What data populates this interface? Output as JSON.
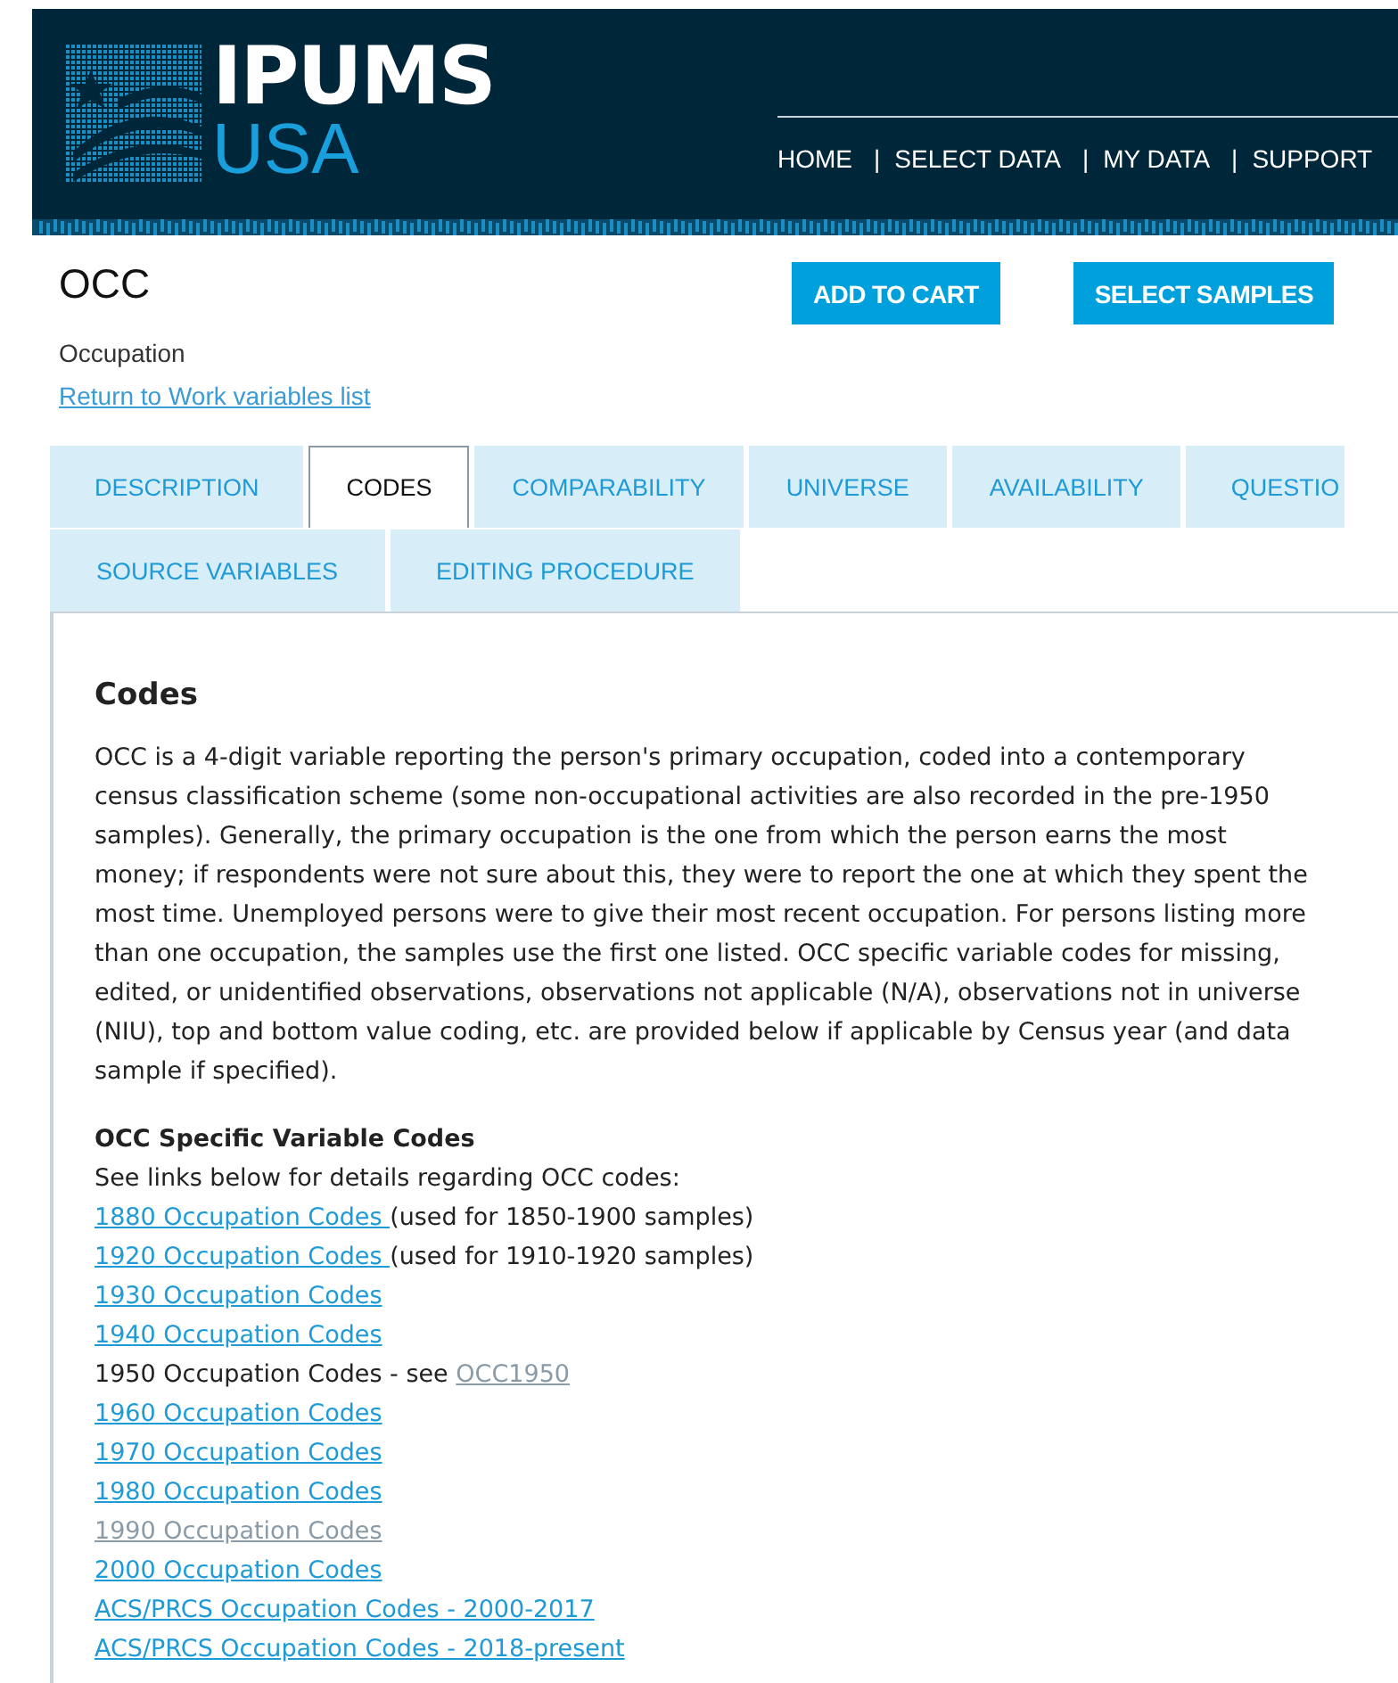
{
  "header": {
    "logo_top": "IPUMS",
    "logo_bottom": "USA",
    "nav": [
      {
        "label": "HOME"
      },
      {
        "label": "SELECT DATA",
        "separator": "|"
      },
      {
        "label": "MY DATA",
        "separator": "|"
      },
      {
        "label": "SUPPORT",
        "separator": "|"
      }
    ]
  },
  "variable": {
    "name": "OCC",
    "label": "Occupation",
    "back_link": "Return to Work variables list"
  },
  "buttons": [
    "ADD TO CART",
    "SELECT SAMPLES"
  ],
  "tab_rows": [
    [
      {
        "label": "DESCRIPTION",
        "selected": false
      },
      {
        "label": "CODES",
        "selected": true
      },
      {
        "label": "COMPARABILITY",
        "selected": false
      },
      {
        "label": "UNIVERSE",
        "selected": false
      },
      {
        "label": "AVAILABILITY",
        "selected": false
      },
      {
        "label": "QUESTIO",
        "selected": false
      }
    ],
    [
      {
        "label": "SOURCE VARIABLES",
        "selected": false
      },
      {
        "label": "EDITING PROCEDURE",
        "selected": false
      }
    ]
  ],
  "panel": {
    "heading": "Codes",
    "paragraph": "OCC is a 4-digit variable reporting the person's primary occupation, coded into a contemporary census classification scheme (some non-occupational activities are also recorded in the pre-1950 samples). Generally, the primary occupation is the one from which the person earns the most money; if respondents were not sure about this, they were to report the one at which they spent the most time. Unemployed persons were to give their most recent occupation. For persons listing more than one occupation, the samples use the first one listed. OCC specific variable codes for missing, edited, or unidentified observations, observations not applicable (N/A), observations not in universe (NIU), top and bottom value coding, etc. are provided below if applicable by Census year (and data sample if specified).",
    "subheading": "OCC Specific Variable Codes",
    "intro": "See links below for details regarding OCC codes:",
    "code_items": [
      {
        "link": "1880 Occupation Codes ",
        "suffix": "(used for 1850-1900 samples)",
        "visited": false
      },
      {
        "link": "1920 Occupation Codes ",
        "suffix": "(used for 1910-1920 samples)",
        "visited": false
      },
      {
        "link": "1930 Occupation Codes",
        "visited": false
      },
      {
        "link": "1940 Occupation Codes",
        "visited": false
      },
      {
        "prefix": "1950 Occupation Codes - see ",
        "link": "OCC1950",
        "visited": true
      },
      {
        "link": "1960 Occupation Codes",
        "visited": false
      },
      {
        "link": "1970 Occupation Codes",
        "visited": false
      },
      {
        "link": "1980 Occupation Codes",
        "visited": false
      },
      {
        "link": "1990 Occupation Codes",
        "visited": true
      },
      {
        "link": "2000 Occupation Codes",
        "visited": false
      },
      {
        "link": "ACS/PRCS Occupation Codes - 2000-2017",
        "visited": false
      },
      {
        "link": "ACS/PRCS Occupation Codes - 2018-present",
        "visited": false
      }
    ]
  }
}
